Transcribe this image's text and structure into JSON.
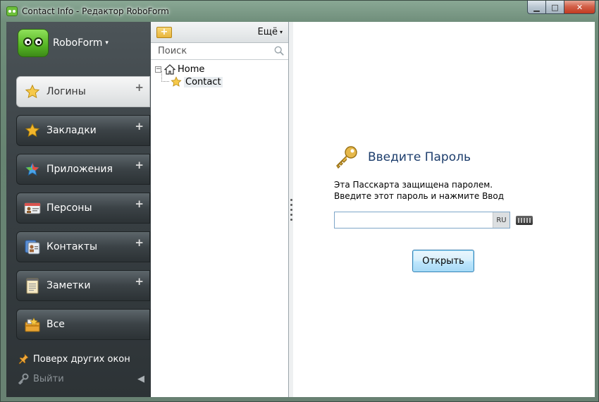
{
  "window": {
    "title": "Contact Info - Редактор RoboForm",
    "controls": {
      "minimize": "▁",
      "maximize": "□",
      "close": "✕"
    }
  },
  "brand": {
    "name": "RoboForm",
    "caret": "▾"
  },
  "sidebar": {
    "items": [
      {
        "label": "Логины",
        "icon": "star-icon",
        "active": true
      },
      {
        "label": "Закладки",
        "icon": "star-icon",
        "active": false
      },
      {
        "label": "Приложения",
        "icon": "apps-star-icon",
        "active": false
      },
      {
        "label": "Персоны",
        "icon": "id-card-icon",
        "active": false
      },
      {
        "label": "Контакты",
        "icon": "contacts-icon",
        "active": false
      },
      {
        "label": "Заметки",
        "icon": "notepad-icon",
        "active": false
      },
      {
        "label": "Все",
        "icon": "all-items-icon",
        "active": false
      }
    ],
    "plus": "+",
    "pin_label": "Поверх других окон",
    "logout_label": "Выйти",
    "logout_arrow": "◀"
  },
  "tree_panel": {
    "more_label": "Ещё",
    "more_caret": "▾",
    "folder_add_glyph": "+",
    "search_placeholder": "Поиск",
    "toggle": "−",
    "root": "Home",
    "child": "Contact"
  },
  "main": {
    "heading": "Введите Пароль",
    "desc_line1": "Эта Пасскарта защищена паролем.",
    "desc_line2": "Введите этот пароль и нажмите Ввод",
    "password_value": "",
    "lang": "RU",
    "open_button": "Открыть"
  },
  "colors": {
    "accent": "#1c3d6c",
    "button_border": "#3c7fb1",
    "brand_green": "#55b524"
  }
}
